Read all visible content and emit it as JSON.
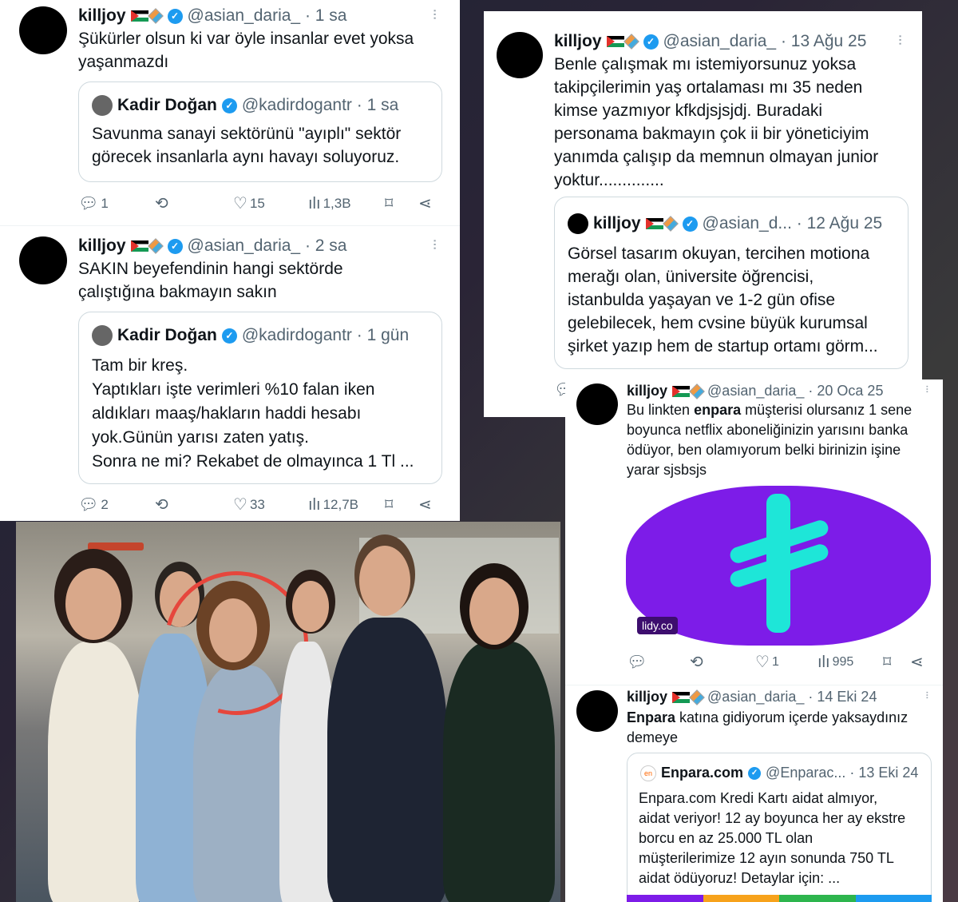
{
  "t1": {
    "name": "killjoy",
    "handle": "@asian_daria_",
    "time": "· 1 sa",
    "text": "Şükürler olsun ki var öyle insanlar evet yoksa\nyaşanmazdı",
    "q": {
      "name": "Kadir Doğan",
      "handle": "@kadirdogantr",
      "time": "· 1 sa",
      "text": "Savunma sanayi sektörünü \"ayıplı\" sektör\ngörecek insanlarla aynı havayı soluyoruz."
    },
    "replies": "1",
    "likes": "15",
    "views": "1,3B"
  },
  "t2": {
    "name": "killjoy",
    "handle": "@asian_daria_",
    "time": "· 2 sa",
    "text": "SAKIN beyefendinin hangi sektörde\nçalıştığına bakmayın sakın",
    "q": {
      "name": "Kadir Doğan",
      "handle": "@kadirdogantr",
      "time": "· 1 gün",
      "text": "Tam bir kreş.\nYaptıkları işte verimleri %10 falan iken\naldıkları maaş/hakların haddi hesabı\nyok.Günün yarısı zaten yatış.\nSonra ne mi? Rekabet de olmayınca 1 Tl ..."
    },
    "replies": "2",
    "likes": "33",
    "views": "12,7B"
  },
  "t3": {
    "name": "killjoy",
    "handle": "@asian_daria_",
    "time": "· 13 Ağu 25",
    "text": "Benle çalışmak mı istemiyorsunuz yoksa\ntakipçilerimin yaş ortalaması mı 35 neden\nkimse yazmıyor kfkdjsjsjdj. Buradaki\npersonama bakmayın çok ii bir yöneticiyim\nyanımda çalışıp da memnun olmayan junior\nyoktur..............",
    "q": {
      "name": "killjoy",
      "handle": "@asian_d...",
      "time": "· 12 Ağu 25",
      "text": "Görsel tasarım okuyan, tercihen motiona\nmerağı olan, üniversite öğrencisi,\nistanbulda yaşayan ve 1-2 gün ofise\ngelebilecek, hem cvsine büyük kurumsal\nşirket yazıp hem de startup ortamı görm..."
    }
  },
  "t4": {
    "name": "killjoy",
    "handle": "@asian_daria_",
    "time": "· 20 Oca 25",
    "text_before": "Bu linkten ",
    "text_bold": "enpara",
    "text_after": " müşterisi olursanız 1 sene\nboyunca netflix aboneliğinizin yarısını banka\nödüyor, ben olamıyorum belki birinizin işine\nyarar sjsbsjs",
    "card_domain": "lidy.co",
    "likes": "1",
    "views": "995"
  },
  "t5": {
    "name": "killjoy",
    "handle": "@asian_daria_",
    "time": "· 14 Eki 24",
    "text_bold": "Enpara",
    "text_after": " katına gidiyorum içerde yaksaydınız\ndemeye",
    "q": {
      "name": "Enpara.com",
      "handle": "@Enparac...",
      "time": "· 13 Eki 24",
      "avatar_text": "en",
      "text": "Enpara.com Kredi Kartı aidat almıyor,\naidat veriyor! 12 ay boyunca her ay ekstre\nborcu en az 25.000 TL olan\nmüşterilerimize 12 ayın sonunda 750 TL\naidat ödüyoruz! Detaylar için: ..."
    }
  },
  "colors": {
    "accent": "#1d9bf0",
    "circle": "#e6463c",
    "enpara_purple": "#7d1ce8",
    "enpara_teal": "#1ee6d8"
  }
}
